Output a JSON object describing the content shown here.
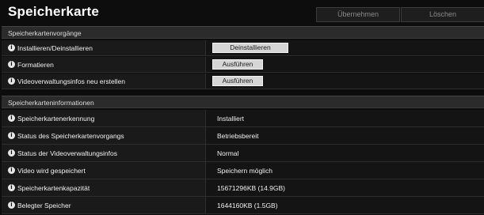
{
  "header": {
    "title": "Speicherkarte",
    "apply_label": "Übernehmen",
    "delete_label": "Löschen"
  },
  "operations": {
    "section_title": "Speicherkartenvorgänge",
    "rows": [
      {
        "label": "Installieren/Deinstallieren",
        "button": "Deinstallieren"
      },
      {
        "label": "Formatieren",
        "button": "Ausführen"
      },
      {
        "label": "Videoverwaltungsinfos neu erstellen",
        "button": "Ausführen"
      }
    ]
  },
  "information": {
    "section_title": "Speicherkarteninformationen",
    "rows": [
      {
        "label": "Speicherkartenerkennung",
        "value": "Installiert"
      },
      {
        "label": "Status des Speicherkartenvorgangs",
        "value": "Betriebsbereit"
      },
      {
        "label": "Status der Videoverwaltungsinfos",
        "value": "Normal"
      },
      {
        "label": "Video wird gespeichert",
        "value": "Speichern möglich"
      },
      {
        "label": "Speicherkartenkapazität",
        "value": "15671296KB (14.9GB)"
      },
      {
        "label": "Belegter Speicher",
        "value": "1644160KB (1.5GB)"
      }
    ]
  },
  "icons": {
    "info_icon": "info-icon"
  },
  "colors": {
    "background": "#0d0d0d",
    "section_header": "#2b2b2b",
    "button_face": "#d6d6d6"
  }
}
